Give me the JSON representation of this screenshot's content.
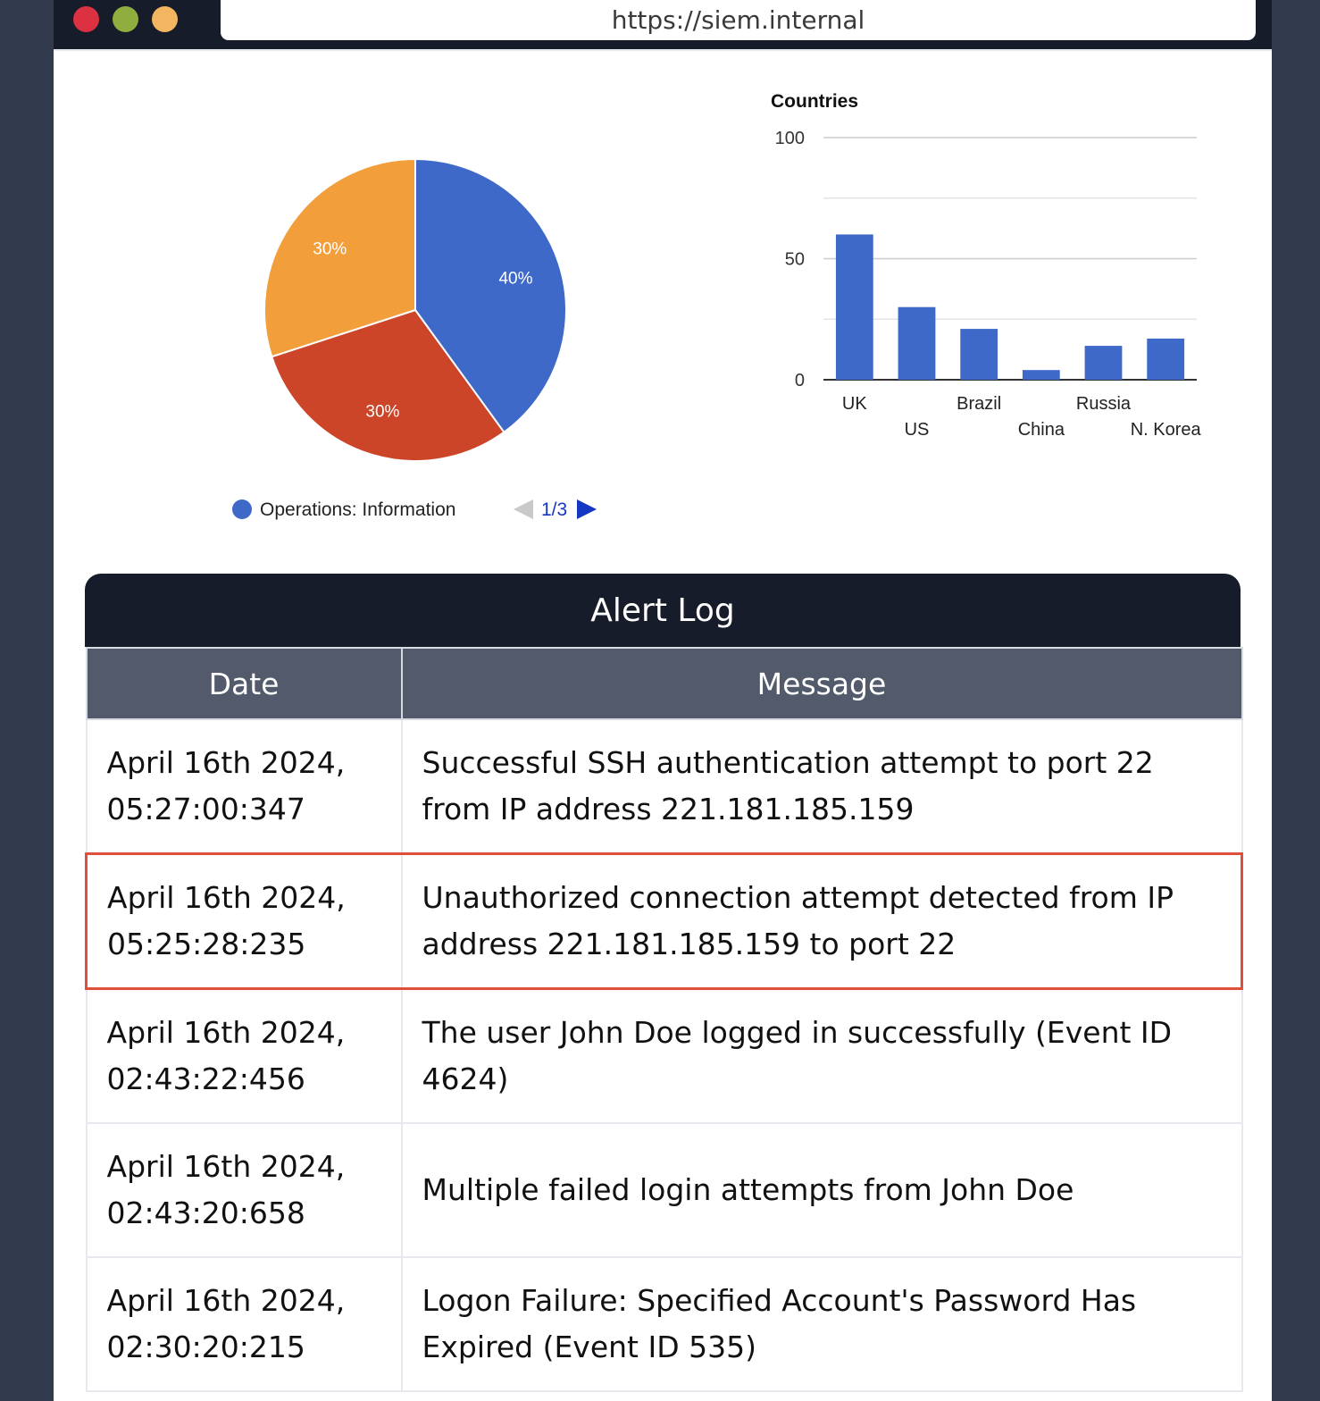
{
  "browser": {
    "url": "https://siem.internal"
  },
  "pie_chart": {
    "slices": [
      {
        "label": "40%",
        "value": 40,
        "color": "#3f69c8"
      },
      {
        "label": "30%",
        "value": 30,
        "color": "#cc4528"
      },
      {
        "label": "30%",
        "value": 30,
        "color": "#f29e3a"
      }
    ],
    "legend": {
      "label": "Operations: Information",
      "color": "#3f69c8"
    },
    "pager": {
      "text": "1/3"
    }
  },
  "chart_data": {
    "type": "bar",
    "title": "Countries",
    "categories": [
      "UK",
      "US",
      "Brazil",
      "China",
      "Russia",
      "N. Korea"
    ],
    "values": [
      60,
      30,
      21,
      4,
      14,
      17
    ],
    "ylim": [
      0,
      100
    ],
    "yticks": [
      "0",
      "50",
      "100"
    ],
    "xlabel": "",
    "ylabel": "",
    "grid": true,
    "color": "#3f69c8"
  },
  "alert_log": {
    "title": "Alert Log",
    "columns": [
      "Date",
      "Message"
    ],
    "rows": [
      {
        "date": "April 16th 2024, 05:27:00:347",
        "message": "Successful SSH authentication attempt to port 22 from IP address 221.181.185.159",
        "highlight": false
      },
      {
        "date": "April 16th 2024, 05:25:28:235",
        "message": "Unauthorized connection attempt detected from IP address 221.181.185.159 to port 22",
        "highlight": true
      },
      {
        "date": "April 16th 2024, 02:43:22:456",
        "message": "The user John Doe logged in successfully (Event ID 4624)",
        "highlight": false
      },
      {
        "date": "April 16th 2024, 02:43:20:658",
        "message": "Multiple failed login attempts from John Doe",
        "highlight": false
      },
      {
        "date": "April 16th 2024, 02:30:20:215",
        "message": "Logon Failure: Specified Account's Password Has Expired (Event ID 535)",
        "highlight": false
      }
    ]
  }
}
